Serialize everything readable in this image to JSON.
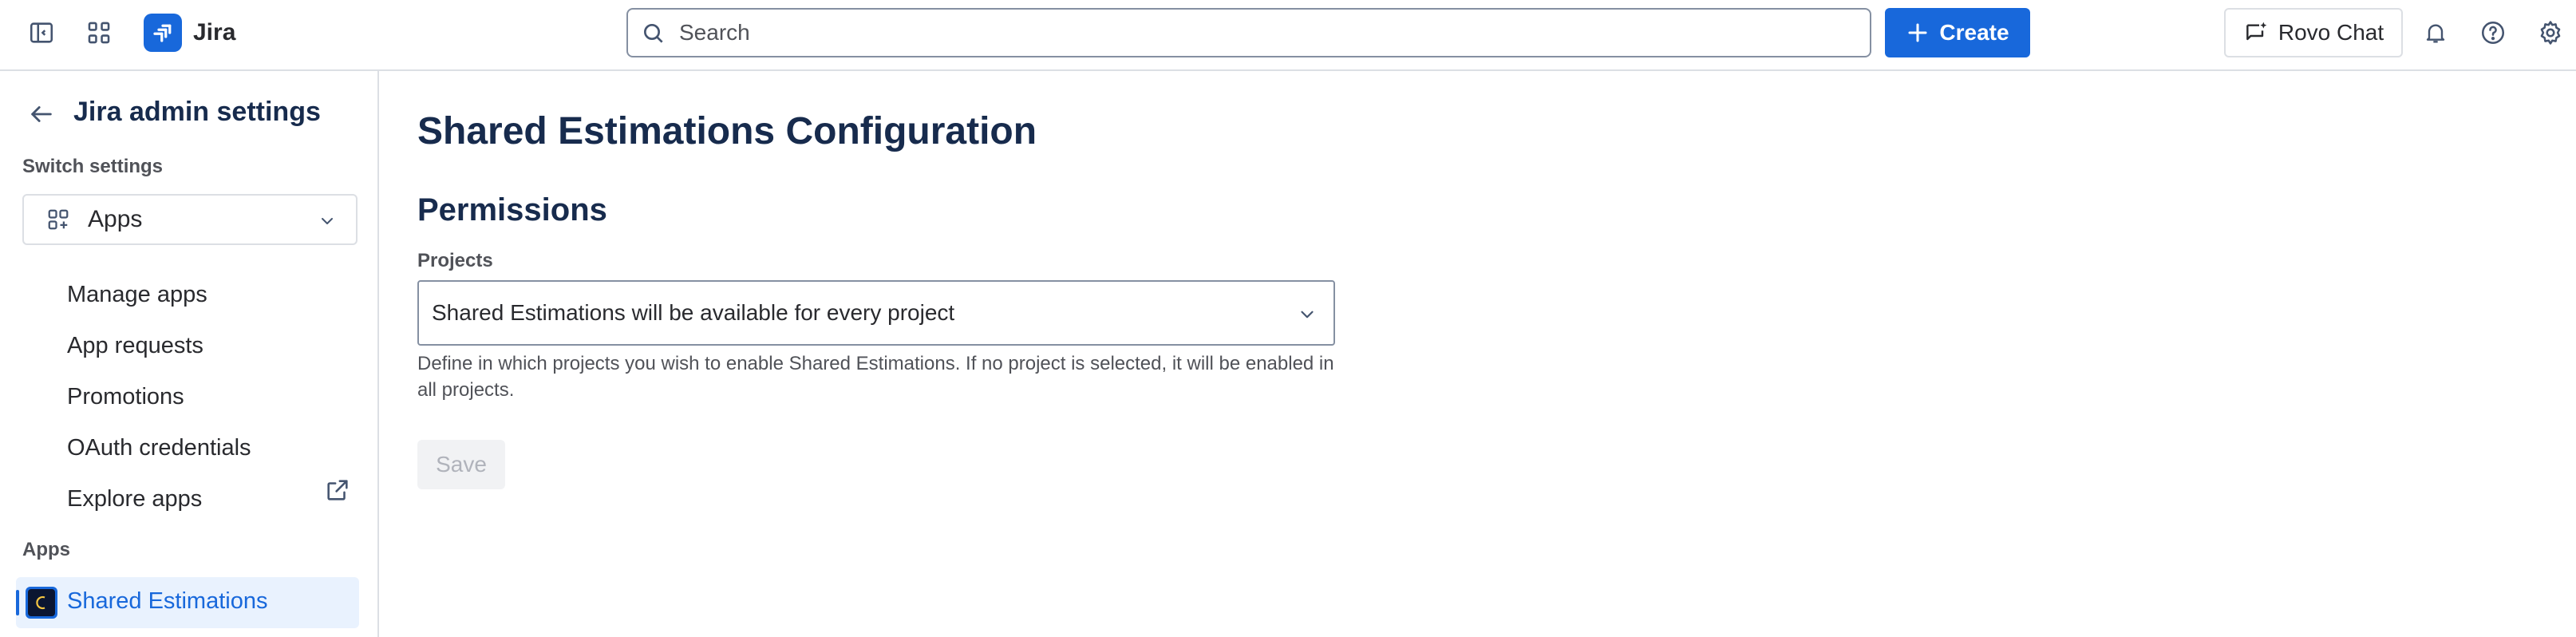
{
  "topbar": {
    "app_name": "Jira",
    "search_placeholder": "Search",
    "create_label": "Create",
    "rovo_label": "Rovo Chat"
  },
  "sidebar": {
    "title": "Jira admin settings",
    "switch_section": "Switch settings",
    "switch_value": "Apps",
    "items": [
      {
        "label": "Manage apps"
      },
      {
        "label": "App requests"
      },
      {
        "label": "Promotions"
      },
      {
        "label": "OAuth credentials"
      },
      {
        "label": "Explore apps"
      }
    ],
    "apps_section": "Apps",
    "active_app": "Shared Estimations"
  },
  "main": {
    "page_title": "Shared Estimations Configuration",
    "section_title": "Permissions",
    "projects_label": "Projects",
    "projects_value": "Shared Estimations will be available for every project",
    "help_text": "Define in which projects you wish to enable Shared Estimations. If no project is selected, it will be enabled in all projects.",
    "save_label": "Save"
  },
  "colors": {
    "brand_blue": "#1868db",
    "active_bg": "#e9f2fe",
    "text_primary": "#172b4d",
    "text_subtle": "#505258",
    "border": "#dcdfe4"
  }
}
